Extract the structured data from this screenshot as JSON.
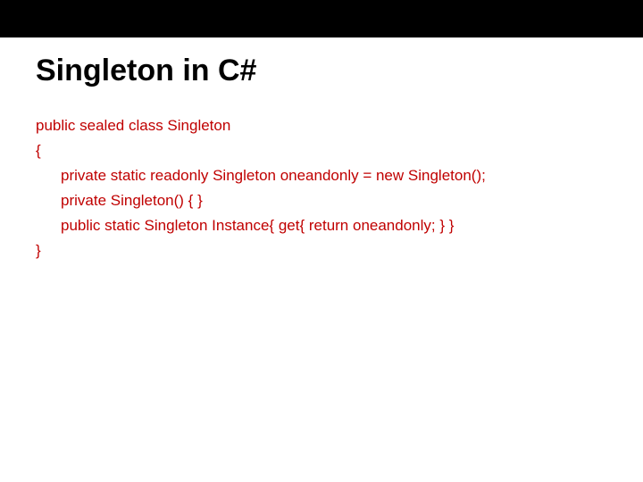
{
  "slide": {
    "title": "Singleton in C#",
    "code": {
      "line1": "public sealed class Singleton",
      "line2": "{",
      "line3": "private static readonly Singleton oneandonly = new Singleton();",
      "line4": "private Singleton() { }",
      "line5": "public static Singleton Instance{ get{ return oneandonly; } }",
      "line6": "}"
    }
  }
}
